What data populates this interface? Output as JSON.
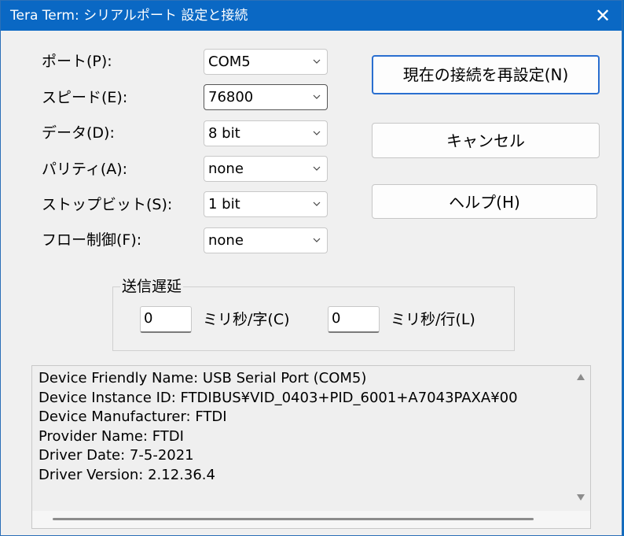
{
  "window": {
    "title": "Tera Term: シリアルポート 設定と接続",
    "close_glyph": "✕"
  },
  "fields": [
    {
      "label": "ポート(P):",
      "value": "COM5"
    },
    {
      "label": "スピード(E):",
      "value": "76800"
    },
    {
      "label": "データ(D):",
      "value": "8 bit"
    },
    {
      "label": "パリティ(A):",
      "value": "none"
    },
    {
      "label": "ストップビット(S):",
      "value": "1 bit"
    },
    {
      "label": "フロー制御(F):",
      "value": "none"
    }
  ],
  "buttons": {
    "reconnect": "現在の接続を再設定(N)",
    "cancel": "キャンセル",
    "help": "ヘルプ(H)"
  },
  "delay": {
    "title": "送信遅延",
    "char_value": "0",
    "char_label": "ミリ秒/字(C)",
    "line_value": "0",
    "line_label": "ミリ秒/行(L)"
  },
  "info_lines": [
    "Device Friendly Name: USB Serial Port (COM5)",
    "Device Instance ID: FTDIBUS¥VID_0403+PID_6001+A7043PAXA¥00",
    "Device Manufacturer: FTDI",
    "Provider Name: FTDI",
    "Driver Date: 7-5-2021",
    "Driver Version: 2.12.36.4"
  ]
}
